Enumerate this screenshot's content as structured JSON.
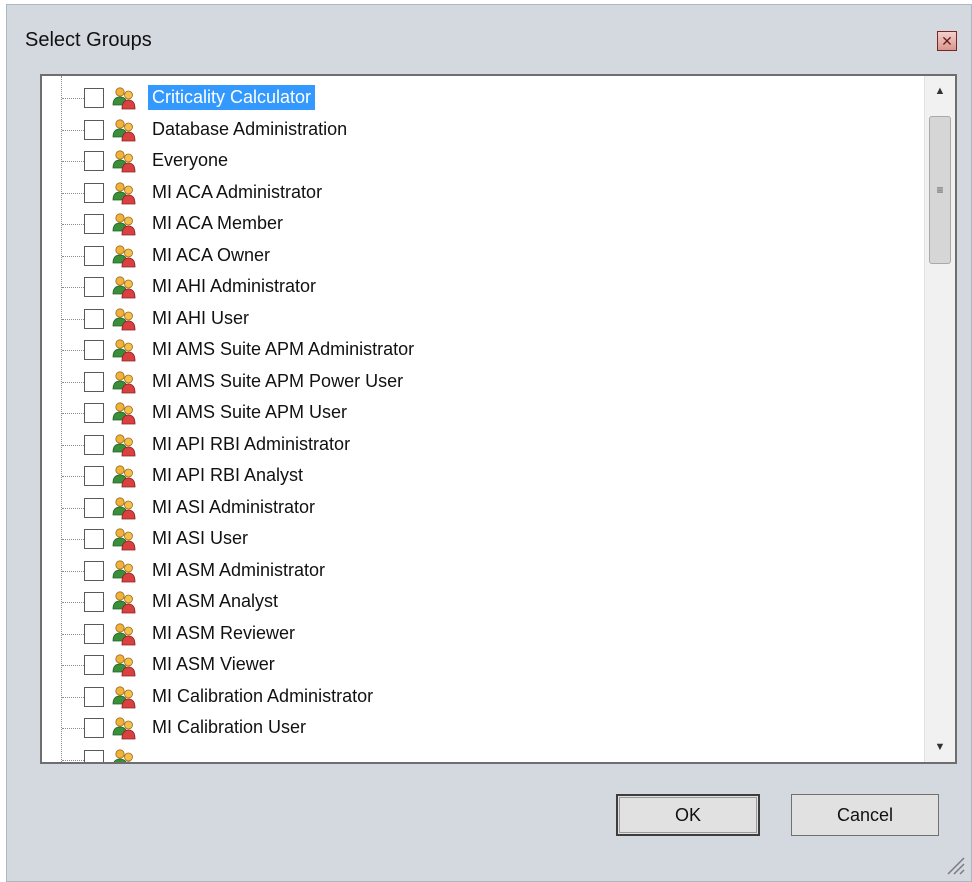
{
  "dialog": {
    "title": "Select Groups",
    "close_icon": "close-icon",
    "ok_label": "OK",
    "cancel_label": "Cancel"
  },
  "groups": [
    {
      "label": "Criticality Calculator",
      "checked": false,
      "selected": true
    },
    {
      "label": "Database Administration",
      "checked": false,
      "selected": false
    },
    {
      "label": "Everyone",
      "checked": false,
      "selected": false
    },
    {
      "label": "MI ACA Administrator",
      "checked": false,
      "selected": false
    },
    {
      "label": "MI ACA Member",
      "checked": false,
      "selected": false
    },
    {
      "label": "MI ACA Owner",
      "checked": false,
      "selected": false
    },
    {
      "label": "MI AHI Administrator",
      "checked": false,
      "selected": false
    },
    {
      "label": "MI AHI User",
      "checked": false,
      "selected": false
    },
    {
      "label": "MI AMS Suite APM Administrator",
      "checked": false,
      "selected": false
    },
    {
      "label": "MI AMS Suite APM Power User",
      "checked": false,
      "selected": false
    },
    {
      "label": "MI AMS Suite APM User",
      "checked": false,
      "selected": false
    },
    {
      "label": "MI API RBI Administrator",
      "checked": false,
      "selected": false
    },
    {
      "label": "MI API RBI Analyst",
      "checked": false,
      "selected": false
    },
    {
      "label": "MI ASI Administrator",
      "checked": false,
      "selected": false
    },
    {
      "label": "MI ASI User",
      "checked": false,
      "selected": false
    },
    {
      "label": "MI ASM Administrator",
      "checked": false,
      "selected": false
    },
    {
      "label": "MI ASM Analyst",
      "checked": false,
      "selected": false
    },
    {
      "label": "MI ASM Reviewer",
      "checked": false,
      "selected": false
    },
    {
      "label": "MI ASM Viewer",
      "checked": false,
      "selected": false
    },
    {
      "label": "MI Calibration Administrator",
      "checked": false,
      "selected": false
    },
    {
      "label": "MI Calibration User",
      "checked": false,
      "selected": false
    },
    {
      "label": "",
      "checked": false,
      "selected": false
    }
  ],
  "colors": {
    "selection": "#3399ff",
    "dialog_bg": "#d4d9df"
  }
}
